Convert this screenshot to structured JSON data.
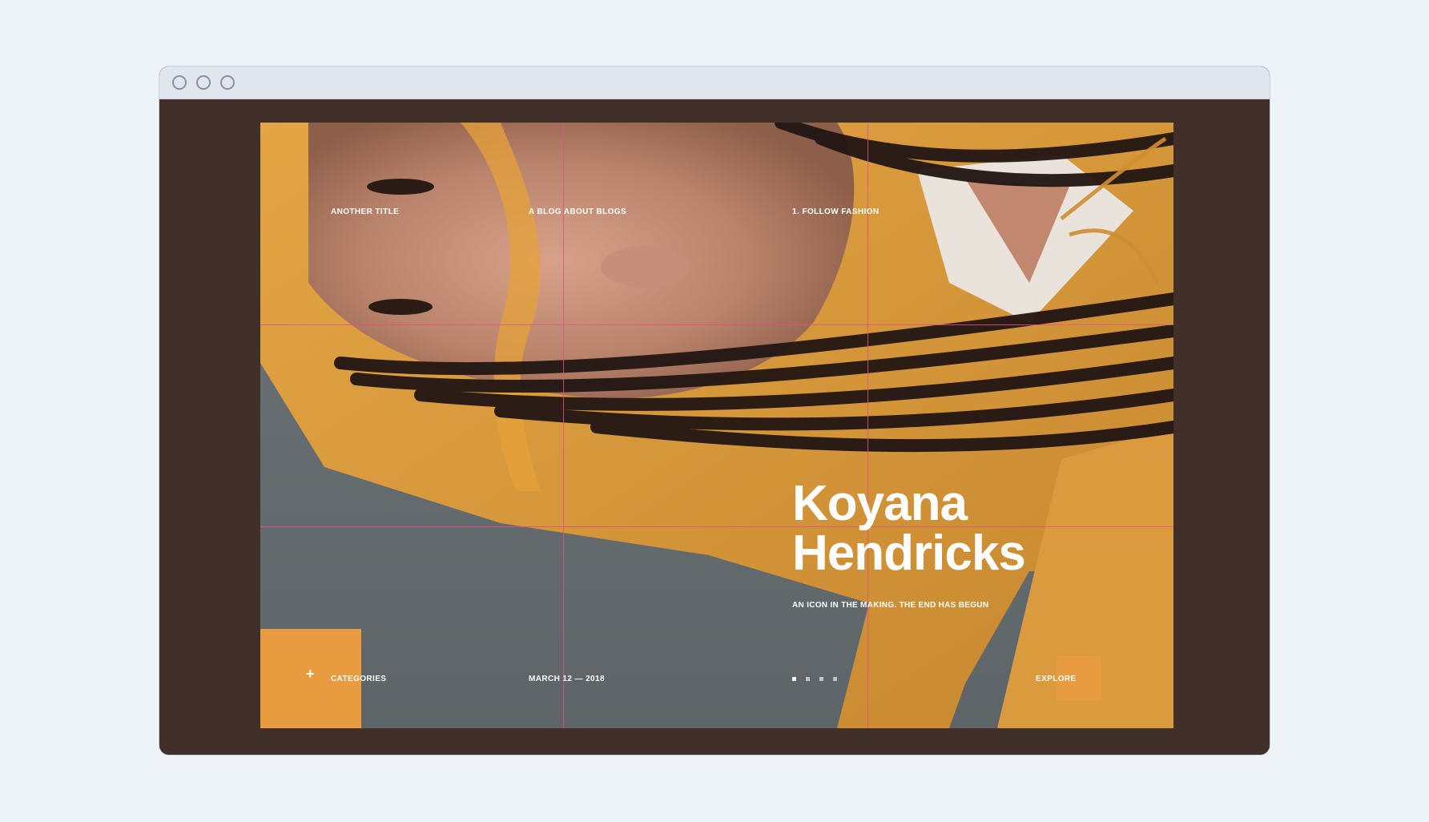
{
  "nav": {
    "item1": "ANOTHER TITLE",
    "item2": "A BLOG ABOUT BLOGS",
    "item3": "1. FOLLOW FASHION"
  },
  "hero": {
    "title_line1": "Koyana",
    "title_line2": "Hendricks",
    "subtitle": "AN ICON IN THE MAKING. THE END HAS BEGUN"
  },
  "footer": {
    "categories_label": "CATEGORIES",
    "date": "MARCH 12 — 2018",
    "explore_label": "EXPLORE",
    "pages": 4,
    "active_page": 1
  },
  "colors": {
    "accent": "#e99b40",
    "grid": "#e0508a",
    "frame": "#41302a"
  }
}
